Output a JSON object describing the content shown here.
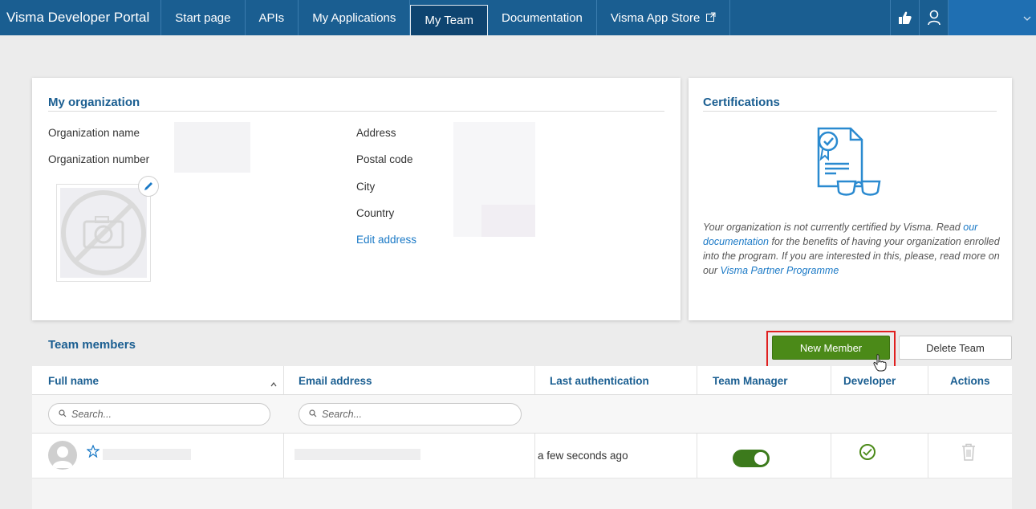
{
  "nav": {
    "brand": "Visma Developer Portal",
    "items": [
      {
        "label": "Start page"
      },
      {
        "label": "APIs"
      },
      {
        "label": "My Applications"
      },
      {
        "label": "My Team",
        "active": true
      },
      {
        "label": "Documentation"
      },
      {
        "label": "Visma App Store",
        "external_icon": "external-link-icon"
      }
    ],
    "right_icons": [
      "feedback-thumbs-up-icon",
      "user-profile-icon",
      "chevron-down-icon"
    ]
  },
  "organization": {
    "title": "My organization",
    "labels": {
      "name": "Organization name",
      "number": "Organization number",
      "address": "Address",
      "postal_code": "Postal code",
      "city": "City",
      "country": "Country"
    },
    "edit_address": "Edit address",
    "photo_icon": "no-photo-camera-icon",
    "edit_icon": "pencil-icon"
  },
  "certifications": {
    "title": "Certifications",
    "text_before": "Your organization is not currently certified by Visma. Read ",
    "link1": "our documentation",
    "text_middle": " for the benefits of having your organization enrolled into the program. If you are interested in this, please, read more on our ",
    "link2": "Visma Partner Programme",
    "illustration_icon": "certificate-glasses-icon"
  },
  "team": {
    "title": "Team members",
    "new_member": "New Member",
    "delete_team": "Delete Team",
    "columns": {
      "full_name": "Full name",
      "email": "Email address",
      "last_auth": "Last authentication",
      "manager": "Team Manager",
      "developer": "Developer",
      "actions": "Actions"
    },
    "search_placeholder": "Search...",
    "rows": [
      {
        "last_auth": "a few seconds ago",
        "team_manager": true,
        "developer": true
      }
    ],
    "colors": {
      "accent": "#1a5e91",
      "green": "#4b8a18"
    }
  }
}
